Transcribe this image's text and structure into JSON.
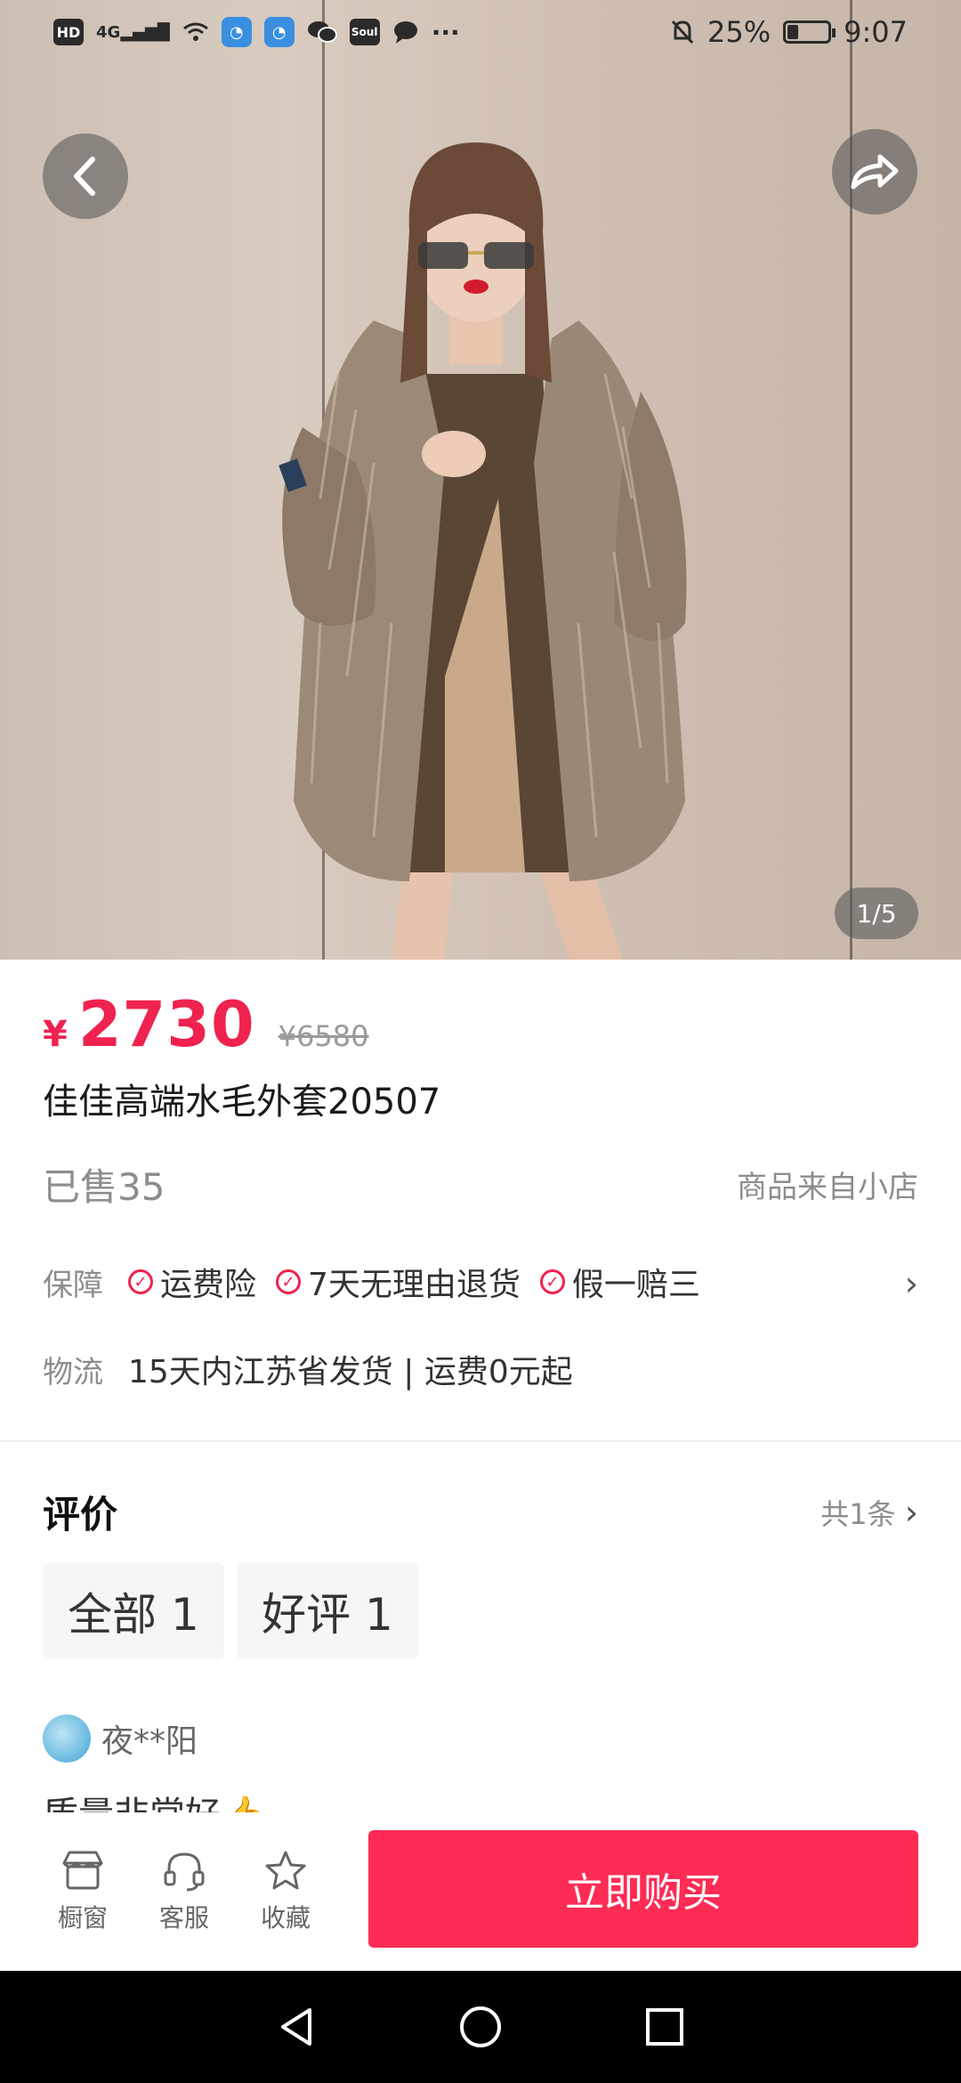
{
  "status_bar": {
    "left_icons": [
      "hd-icon",
      "signal-4g-icon",
      "wifi-icon",
      "app-icon",
      "app-icon",
      "wechat-icon",
      "soul-icon",
      "chat-bubble-icon",
      "more-icon"
    ],
    "hd": "HD",
    "network": "4G",
    "soul": "Soul",
    "more": "···",
    "battery": "25%",
    "time": "9:07"
  },
  "hero": {
    "counter": "1/5"
  },
  "product": {
    "currency": "¥",
    "price": "2730",
    "original_price": "¥6580",
    "title": "佳佳高端水毛外套20507",
    "sold": "已售35",
    "store": "商品来自小店"
  },
  "guarantee": {
    "label": "保障",
    "items": [
      "运费险",
      "7天无理由退货",
      "假一赔三"
    ]
  },
  "logistics": {
    "label": "物流",
    "text": "15天内江苏省发货 | 运费0元起"
  },
  "reviews": {
    "heading": "评价",
    "count": "共1条",
    "chips": [
      "全部 1",
      "好评 1"
    ],
    "reviewer": "夜**阳",
    "text": "质量非常好👍"
  },
  "action_bar": {
    "tools": [
      "橱窗",
      "客服",
      "收藏"
    ],
    "buy": "立即购买"
  },
  "colors": {
    "accent": "#fe2c55",
    "price": "#f0224f"
  }
}
